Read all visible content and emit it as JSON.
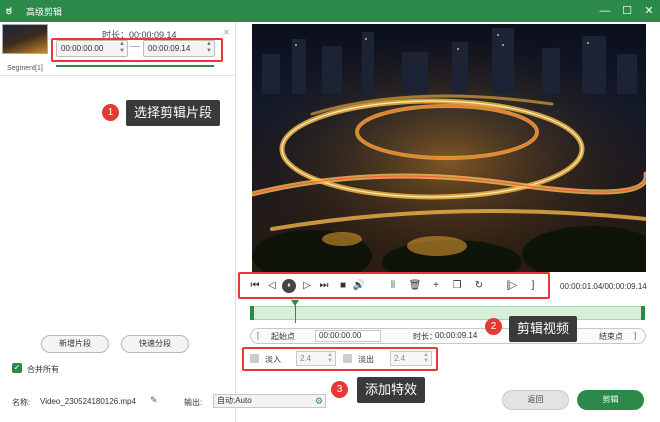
{
  "window": {
    "title": "高级剪辑",
    "logo_glyph": "ಠ",
    "controls": {
      "minimize": "—",
      "maximize": "☐",
      "close": "✕"
    }
  },
  "segment_panel": {
    "duration_label": "时长：00:00:09.14",
    "start_time": "00:00:00.00",
    "end_time": "00:00:09.14",
    "separator": "—",
    "remove_glyph": "✕",
    "segment_tab": "Segment[1]",
    "new_segment_button": "新增片段",
    "quick_split_button": "快速分段",
    "merge_all_label": "合并所有",
    "merge_all_checked": true
  },
  "player": {
    "time_readout": "00:00:01.04/00:00:09.14",
    "progress": 0.114,
    "controls": [
      {
        "name": "go-start-icon",
        "glyph": "⏮"
      },
      {
        "name": "prev-frame-icon",
        "glyph": "◁"
      },
      {
        "name": "pause-icon",
        "glyph": "⏸"
      },
      {
        "name": "next-frame-icon",
        "glyph": "▷"
      },
      {
        "name": "go-end-icon",
        "glyph": "⏭"
      },
      {
        "name": "stop-icon",
        "glyph": "■"
      },
      {
        "name": "volume-icon",
        "glyph": "🔊"
      },
      {
        "name": "split-icon",
        "glyph": "⫴"
      },
      {
        "name": "delete-icon",
        "glyph": "🗑"
      },
      {
        "name": "add-icon",
        "glyph": "+"
      },
      {
        "name": "copy-icon",
        "glyph": "❐"
      },
      {
        "name": "reset-icon",
        "glyph": "↻"
      },
      {
        "name": "mark-in-icon",
        "glyph": "[▷"
      },
      {
        "name": "mark-out-icon",
        "glyph": "]"
      }
    ]
  },
  "trim_row": {
    "start_bracket": "[",
    "start_label": "起始点",
    "start_value": "00:00:00.00",
    "duration_label": "时长：",
    "duration_value": "00:00:09.14",
    "end_label": "结束点",
    "end_bracket": "]"
  },
  "effects": {
    "fade_in_label": "淡入",
    "fade_in_value": "2.4",
    "fade_out_label": "淡出",
    "fade_out_value": "2.4"
  },
  "callouts": [
    {
      "number": "1",
      "text": "选择剪辑片段"
    },
    {
      "number": "2",
      "text": "剪辑视频"
    },
    {
      "number": "3",
      "text": "添加特效"
    }
  ],
  "footer": {
    "name_label": "名称:",
    "file_name": "Video_230524180126.mp4",
    "output_label": "输出:",
    "output_value": "自动;Auto",
    "back_button": "返回",
    "edit_button": "剪辑"
  },
  "colors": {
    "accent": "#2b8a4a",
    "highlight": "#e53935",
    "callout_bg": "#3a3a3a"
  }
}
